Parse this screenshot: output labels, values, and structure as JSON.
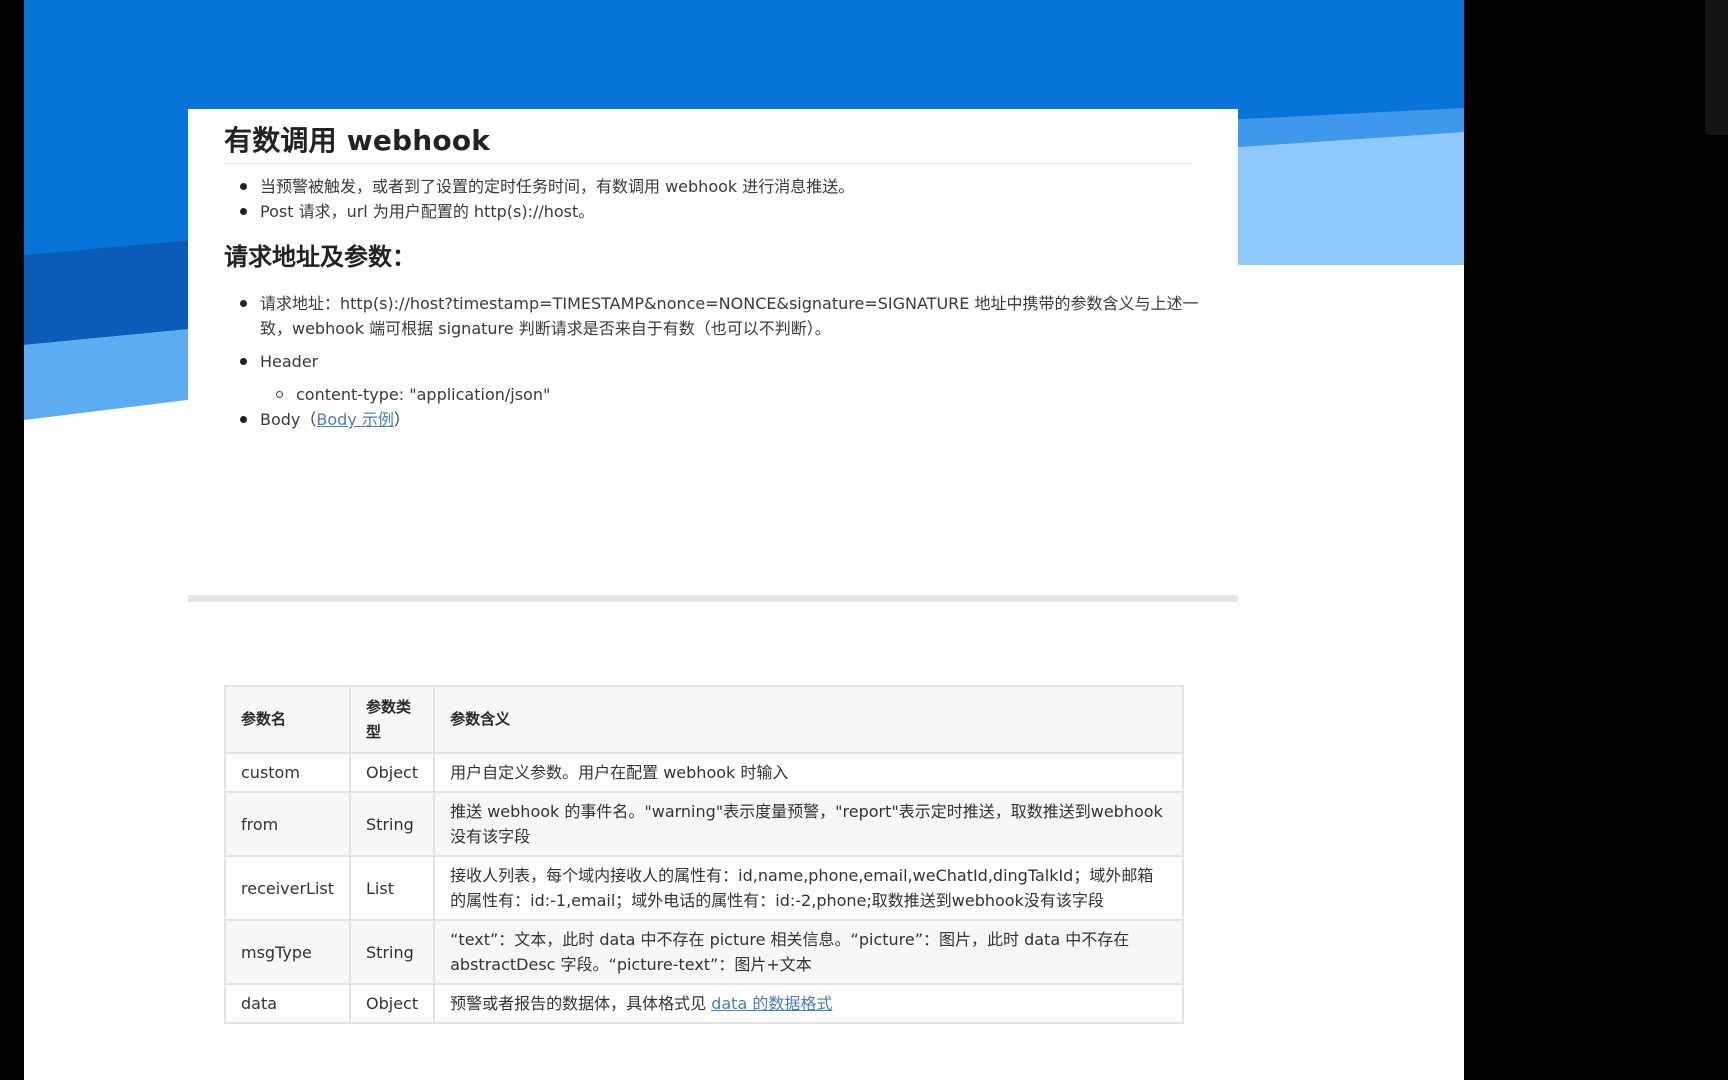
{
  "section1": {
    "title": "有数调用 webhook",
    "bullets": [
      "当预警被触发，或者到了设置的定时任务时间，有数调用 webhook 进行消息推送。",
      "Post 请求，url 为用户配置的 http(s)://host。"
    ]
  },
  "section2": {
    "title": "请求地址及参数：",
    "request_address_line1": "请求地址：http(s)://host?timestamp=TIMESTAMP&nonce=NONCE&signature=SIGNATURE 地址中携带的参数含义与上述一",
    "request_address_line2": "致，webhook 端可根据 signature 判断请求是否来自于有数（也可以不判断）。",
    "header_label": "Header",
    "header_value": "content-type: \"application/json\"",
    "body_prefix": "Body（",
    "body_link": "Body 示例",
    "body_suffix": "）"
  },
  "table": {
    "headers": [
      "参数名",
      "参数类型",
      "参数含义"
    ],
    "rows": [
      {
        "name": "custom",
        "type": "Object",
        "desc": "用户自定义参数。用户在配置 webhook 时输入",
        "link": ""
      },
      {
        "name": "from",
        "type": "String",
        "desc": "推送 webhook 的事件名。\"warning\"表示度量预警，\"report\"表示定时推送，取数推送到webhook没有该字段",
        "link": ""
      },
      {
        "name": "receiverList",
        "type": "List",
        "desc": "接收人列表，每个域内接收人的属性有：id,name,phone,email,weChatId,dingTalkId；域外邮箱的属性有：id:-1,email；域外电话的属性有：id:-2,phone;取数推送到webhook没有该字段",
        "link": ""
      },
      {
        "name": "msgType",
        "type": "String",
        "desc": "“text”：文本，此时 data 中不存在 picture 相关信息。“picture”：图片，此时 data 中不存在 abstractDesc 字段。“picture-text”：图片+文本",
        "link": ""
      },
      {
        "name": "data",
        "type": "Object",
        "desc": "预警或者报告的数据体，具体格式见 ",
        "link": "data 的数据格式"
      }
    ]
  },
  "colors": {
    "blue_dark": "#0a5cb6",
    "blue_mid": "#0b7de0",
    "blue_light": "#8fc8fa",
    "link": "#4a7fb8"
  }
}
